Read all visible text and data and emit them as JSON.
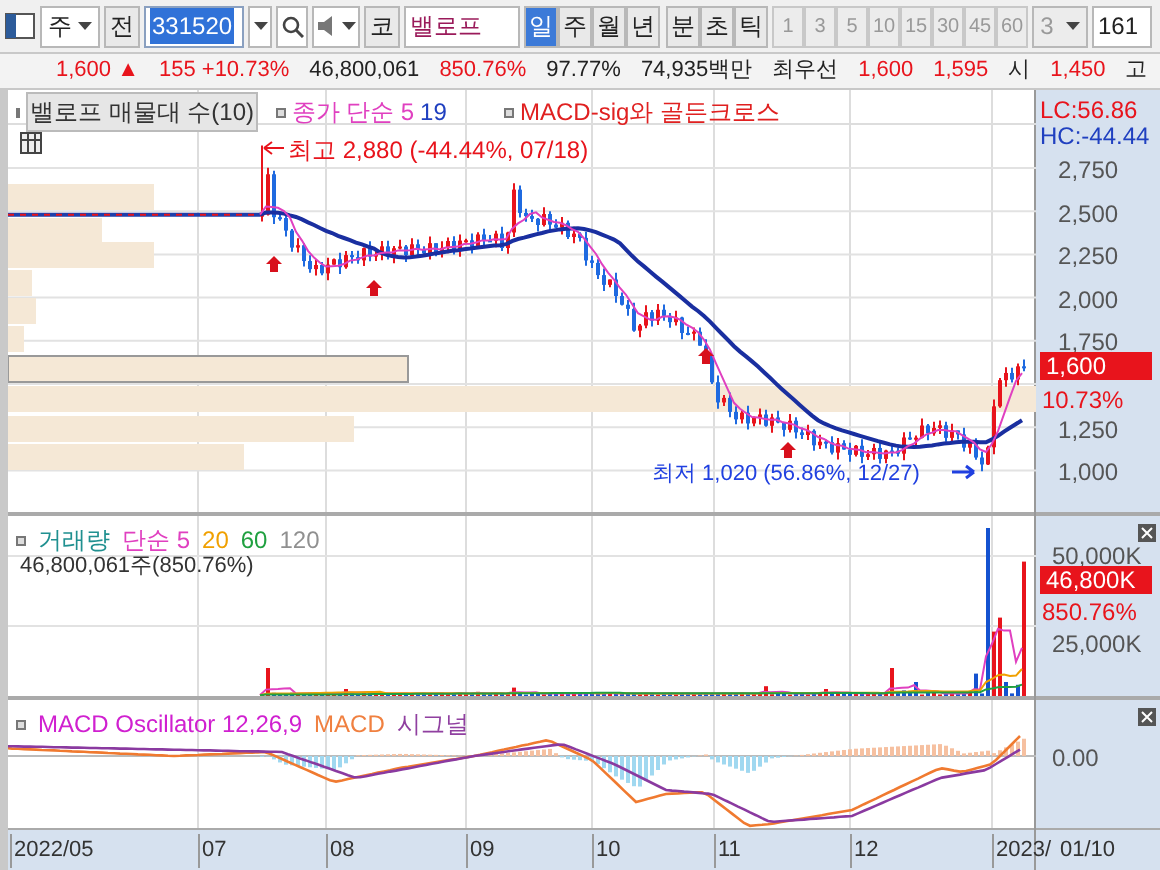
{
  "toolbar": {
    "market": "주",
    "prev_button": "전",
    "code": "331520",
    "name_button": "코",
    "name": "밸로프",
    "periods": [
      {
        "label": "일",
        "selected": true
      },
      {
        "label": "주",
        "selected": false
      },
      {
        "label": "월",
        "selected": false
      },
      {
        "label": "년",
        "selected": false
      },
      {
        "label": "분",
        "selected": false
      },
      {
        "label": "초",
        "selected": false
      },
      {
        "label": "틱",
        "selected": false
      }
    ],
    "intervals": [
      "1",
      "3",
      "5",
      "10",
      "15",
      "30",
      "45",
      "60"
    ],
    "count": "3",
    "field": "161"
  },
  "quote": [
    {
      "text": "1,600 ▲",
      "kind": "up"
    },
    {
      "text": "155 +10.73%",
      "kind": "up"
    },
    {
      "text": "46,800,061",
      "kind": "plain"
    },
    {
      "text": "850.76%",
      "kind": "up"
    },
    {
      "text": "97.77%",
      "kind": "plain"
    },
    {
      "text": "74,935백만",
      "kind": "plain"
    },
    {
      "text": "최우선",
      "kind": "plain"
    },
    {
      "text": "1,600",
      "kind": "up"
    },
    {
      "text": "1,595",
      "kind": "up"
    },
    {
      "text": "시",
      "kind": "plain"
    },
    {
      "text": "1,450",
      "kind": "up"
    },
    {
      "text": "고",
      "kind": "plain"
    }
  ],
  "price_panel": {
    "legends": [
      {
        "parts": [
          {
            "text": "밸로프 매물대 수(10)",
            "color": "#333333"
          }
        ]
      },
      {
        "parts": [
          {
            "text": "종가",
            "color": "#e040c0"
          },
          {
            "text": "단순 5",
            "color": "#e040c0"
          },
          {
            "text": "19",
            "color": "#2040c0"
          }
        ]
      },
      {
        "parts": [
          {
            "text": "MACD-sig와 골든크로스",
            "color": "#e02020"
          }
        ]
      }
    ],
    "lc": "LC:56.86",
    "hc": "HC:-44.44",
    "high_note": "최고 2,880 (-44.44%, 07/18)",
    "low_note": "최저 1,020 (56.86%, 12/27)",
    "ticks": [
      "2,750",
      "2,500",
      "2,250",
      "2,000",
      "1,750",
      "1,250",
      "1,000"
    ],
    "last_price": "1,600",
    "last_change": "10.73%"
  },
  "volume_panel": {
    "legends": [
      {
        "text": "거래량",
        "color": "#209090"
      },
      {
        "text": "단순 5",
        "color": "#e040c0"
      },
      {
        "text": "20",
        "color": "#f0a000"
      },
      {
        "text": "60",
        "color": "#20a040"
      },
      {
        "text": "120",
        "color": "#909090"
      }
    ],
    "summary": "46,800,061주(850.76%)",
    "ticks": [
      "50,000K",
      "25,000K"
    ],
    "last_volume": "46,800K",
    "last_ratio": "850.76%"
  },
  "macd_panel": {
    "legends": [
      {
        "text": "MACD Oscillator 12,26,9",
        "color": "#d020d0"
      },
      {
        "text": "MACD",
        "color": "#f08040"
      },
      {
        "text": "시그널",
        "color": "#9040a0"
      }
    ],
    "ticks": [
      "0.00"
    ]
  },
  "dates": [
    "2022/05",
    "07",
    "08",
    "09",
    "10",
    "11",
    "12",
    "2023/"
  ],
  "axis_date": "01/10"
}
